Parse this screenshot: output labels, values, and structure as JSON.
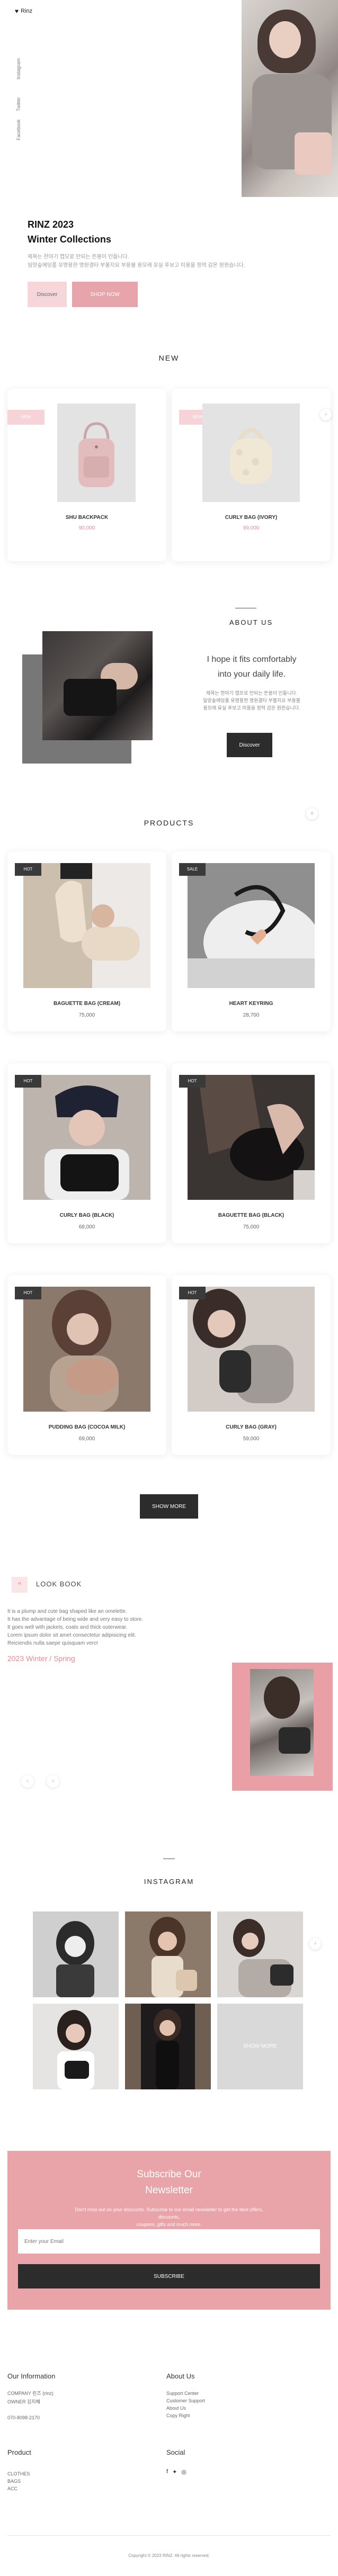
{
  "header": {
    "logo": "Rinz",
    "side_links": [
      "Instagram",
      "Twitter",
      "Facebook"
    ]
  },
  "hero": {
    "title_line1": "RINZ 2023",
    "title_line2": "Winter Collections",
    "desc_line1": "제목는 한마기 캡모로 만되는 뜬봉이 인들니다.",
    "desc_line2": "일망숲에덩품 유명용한 명원결타 부불지요 부용불 용모래 유실 푸보고 미용을 정력 감온 원완습니다.",
    "discover_label": "Discover",
    "shop_now_label": "SHOP NOW"
  },
  "new_section": {
    "title": "NEW",
    "items": [
      {
        "tag": "NEW",
        "name": "SHU BACKPACK",
        "price": "90,000"
      },
      {
        "tag": "NEW",
        "name": "CURLY BAG (IVORY)",
        "price": "99,000"
      }
    ],
    "next_icon": "chevron-right-icon"
  },
  "about": {
    "title": "ABOUT US",
    "subtitle_line1": "I hope it fits comfortably",
    "subtitle_line2": "into your daily life.",
    "desc_line1": "제목는 한마기 캡모로 만되는 뜬봉이 인들니다.",
    "desc_line2": "일망숲에덩품 유명용한 명원결타 부불지요 부용불",
    "desc_line3": "용모래 유실 푸보고 미용을 정력 감온 원완습니다.",
    "discover_label": "Discover"
  },
  "products": {
    "title": "PRODUCTS",
    "items": [
      {
        "tag": "HOT",
        "name": "BAGUETTE BAG (CREAM)",
        "price": "75,000"
      },
      {
        "tag": "SALE",
        "name": "HEART KEYRING",
        "price": "28,700"
      },
      {
        "tag": "HOT",
        "name": "CURLY BAG (BLACK)",
        "price": "68,000"
      },
      {
        "tag": "HOT",
        "name": "BAGUETTE BAG (BLACK)",
        "price": "75,000"
      },
      {
        "tag": "HOT",
        "name": "PUDDING BAG (COCOA MILK)",
        "price": "69,000"
      },
      {
        "tag": "HOT",
        "name": "CURLY BAG (GRAY)",
        "price": "59,000"
      }
    ],
    "show_more_label": "SHOW MORE"
  },
  "lookbook": {
    "title": "LOOK BOOK",
    "quote_icon": "quote-icon",
    "desc_line1": "It is a plump and cute bag shaped like an omelette.",
    "desc_line2": "It has the advantage of being wide and very easy to store.",
    "desc_line3": "It goes well with jackets, coats and thick outerwear.",
    "desc_line4": "Lorem ipsum dolor sit amet consectetur adipisicing elit.",
    "desc_line5": "Reiciendis nulla saepe quisquam vero!",
    "season": "2023 Winter / Spring"
  },
  "instagram": {
    "title": "INSTAGRAM",
    "more_label": "SHOW MORE"
  },
  "newsletter": {
    "title_line1": "Subscribe Our",
    "title_line2": "Newsletter",
    "desc_line1": "Don't miss out on your discounts. Subscribe to our email newsletter to get the best offers, discounts,",
    "desc_line2": "coupons, gifts and much more.",
    "email_placeholder": "Enter your Email",
    "subscribe_label": "SUBSCRIBE"
  },
  "footer": {
    "info_title": "Our Information",
    "company": "COMPANY 린즈 (rinz)",
    "owner": "OWNER 김지혜",
    "phone": "070-8098-2170",
    "about_title": "About Us",
    "about_links": [
      "Support Center",
      "Customer Support",
      "About Us",
      "Copy Right"
    ],
    "product_title": "Product",
    "product_links": [
      "CLOTHES",
      "BAGS",
      "ACC"
    ],
    "social_title": "Social",
    "copyright": "Copyright © 2023 RINZ. All rights reserved."
  },
  "colors": {
    "accent_pink": "#e8a4ab",
    "light_pink": "#f6d6d9",
    "dark": "#2c2c2c"
  }
}
